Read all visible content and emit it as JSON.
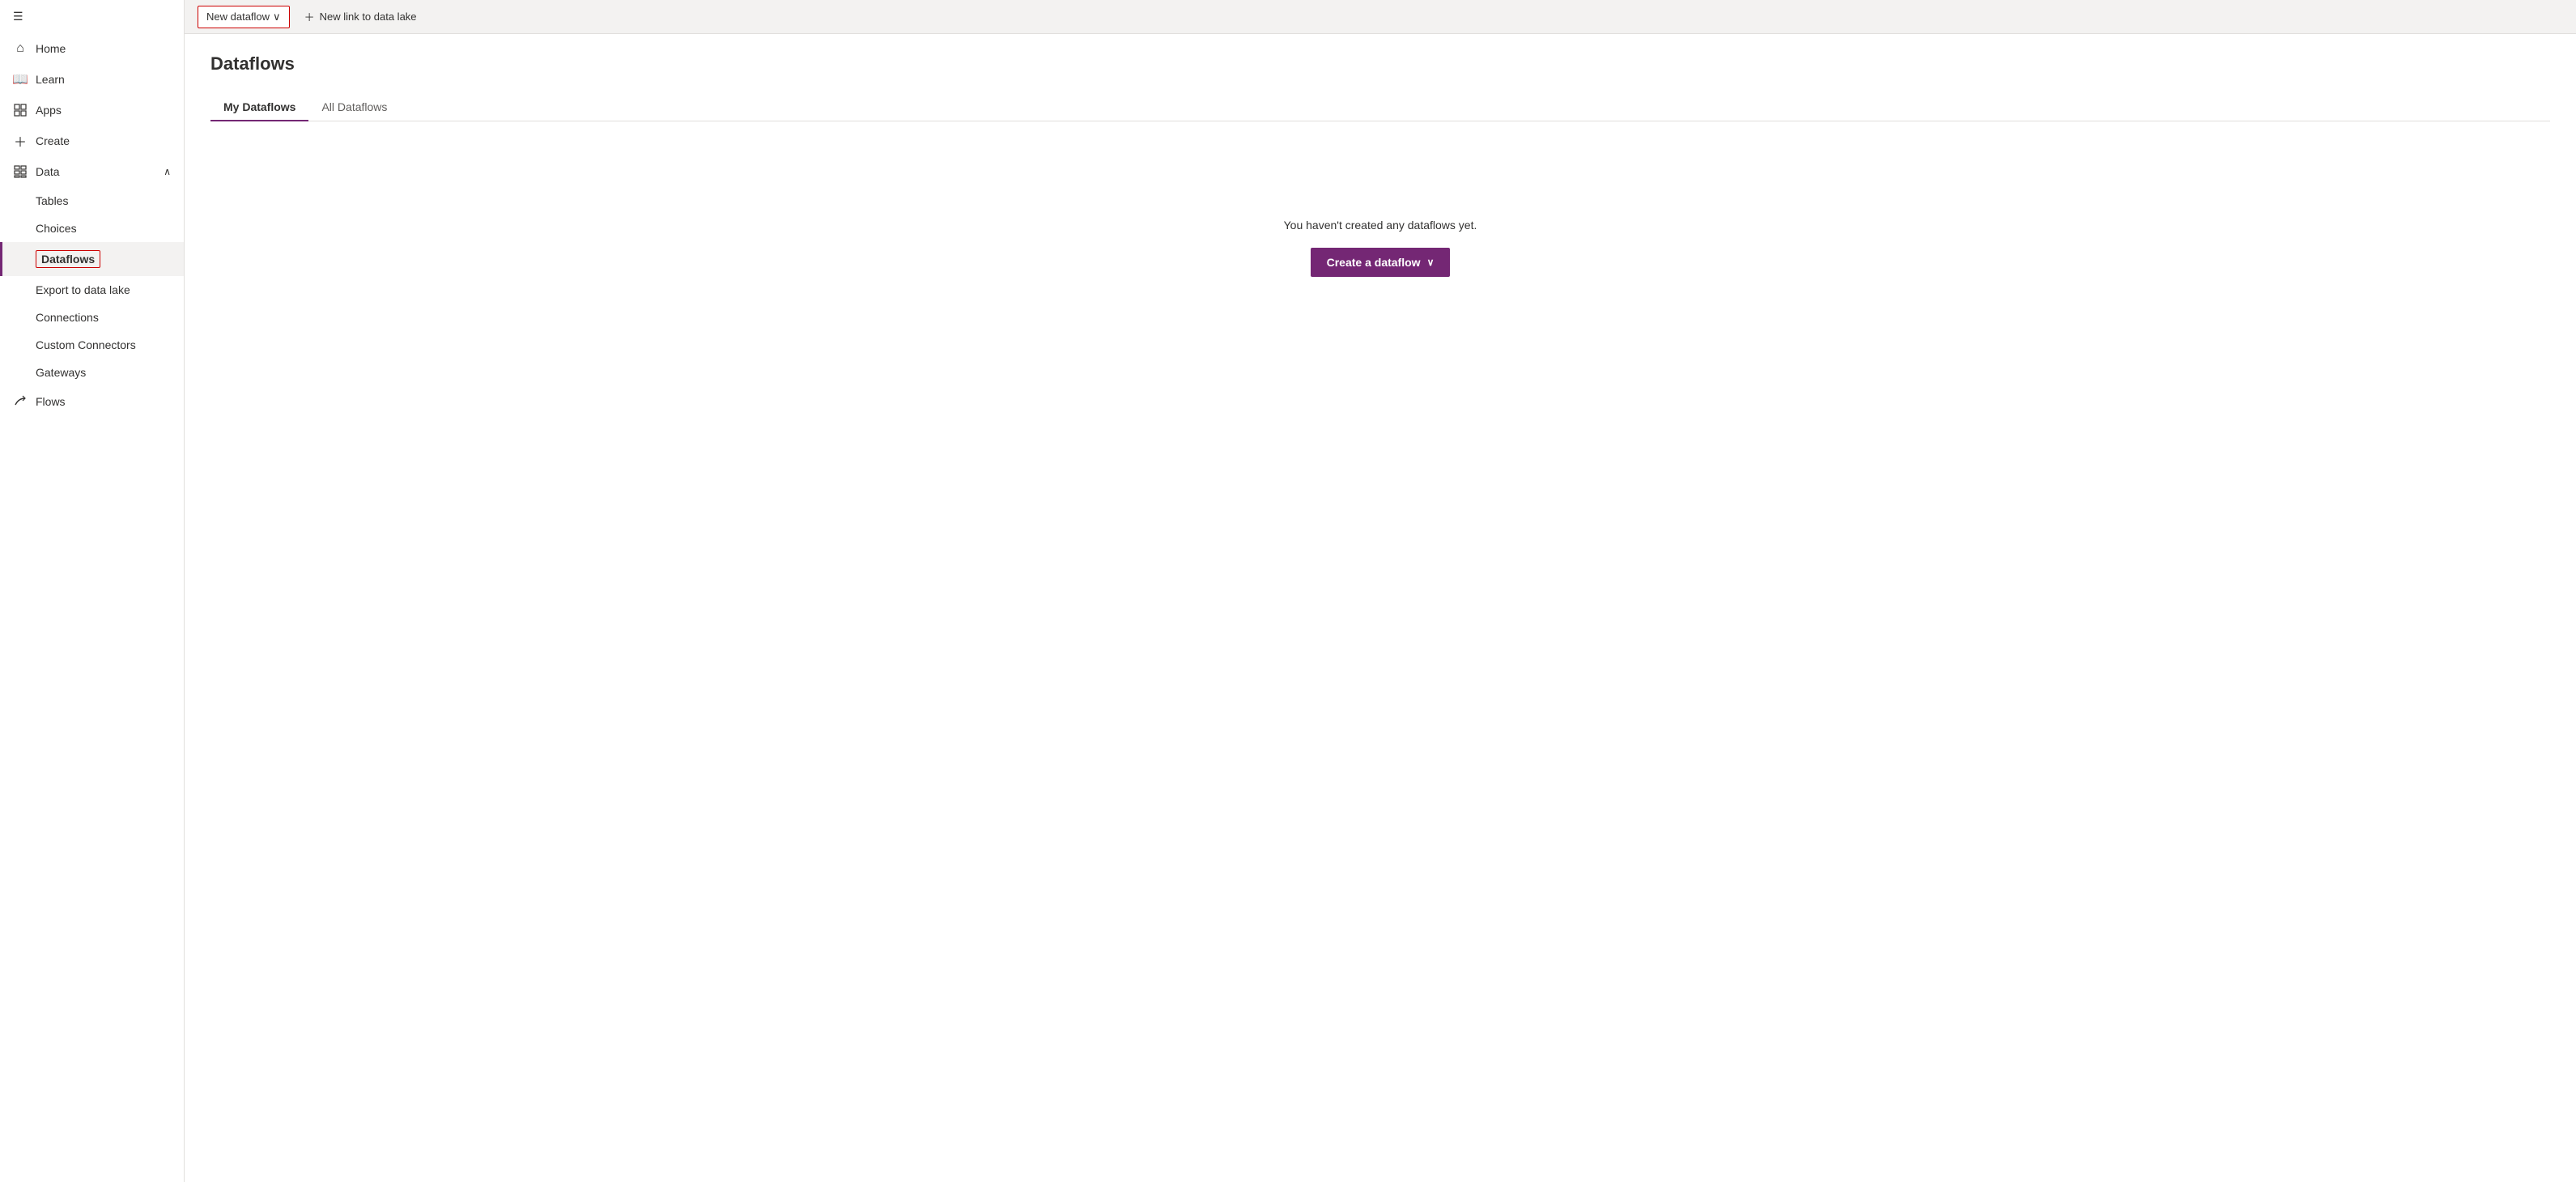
{
  "sidebar": {
    "menu_icon": "☰",
    "items": [
      {
        "id": "home",
        "label": "Home",
        "icon": "⌂"
      },
      {
        "id": "learn",
        "label": "Learn",
        "icon": "📖"
      },
      {
        "id": "apps",
        "label": "Apps",
        "icon": "＋□"
      },
      {
        "id": "create",
        "label": "Create",
        "icon": "＋"
      }
    ],
    "data_section": {
      "label": "Data",
      "icon": "⊞",
      "chevron": "∧",
      "sub_items": [
        {
          "id": "tables",
          "label": "Tables"
        },
        {
          "id": "choices",
          "label": "Choices"
        },
        {
          "id": "dataflows",
          "label": "Dataflows",
          "active": true
        },
        {
          "id": "export",
          "label": "Export to data lake"
        },
        {
          "id": "connections",
          "label": "Connections"
        },
        {
          "id": "custom-connectors",
          "label": "Custom Connectors"
        },
        {
          "id": "gateways",
          "label": "Gateways"
        }
      ]
    },
    "flows": {
      "label": "Flows",
      "icon": "↗"
    }
  },
  "toolbar": {
    "new_dataflow_label": "New dataflow",
    "new_dataflow_chevron": "∨",
    "new_link_label": "New link to data lake",
    "new_link_icon": "＋"
  },
  "content": {
    "page_title": "Dataflows",
    "tabs": [
      {
        "id": "my-dataflows",
        "label": "My Dataflows",
        "active": true
      },
      {
        "id": "all-dataflows",
        "label": "All Dataflows",
        "active": false
      }
    ],
    "empty_state_text": "You haven't created any dataflows yet.",
    "create_button_label": "Create a dataflow",
    "create_button_chevron": "∨"
  }
}
